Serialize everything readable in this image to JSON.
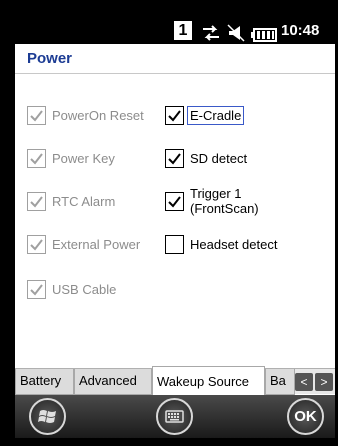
{
  "status_bar": {
    "indicator_number": "1",
    "time": "10:48"
  },
  "page": {
    "title": "Power"
  },
  "checkboxes_left": [
    {
      "label": "PowerOn Reset",
      "checked": true,
      "enabled": false
    },
    {
      "label": "Power Key",
      "checked": true,
      "enabled": false
    },
    {
      "label": "RTC Alarm",
      "checked": true,
      "enabled": false
    },
    {
      "label": "External Power",
      "checked": true,
      "enabled": false
    },
    {
      "label": "USB Cable",
      "checked": true,
      "enabled": false
    }
  ],
  "checkboxes_right": [
    {
      "label": "E-Cradle",
      "checked": true,
      "enabled": true,
      "focused": true
    },
    {
      "label": "SD detect",
      "checked": true,
      "enabled": true
    },
    {
      "label_line1": "Trigger 1",
      "label_line2": "(FrontScan)",
      "checked": true,
      "enabled": true
    },
    {
      "label": "Headset detect",
      "checked": false,
      "enabled": true
    }
  ],
  "tabs": [
    {
      "label": "Battery"
    },
    {
      "label": "Advanced"
    },
    {
      "label": "Wakeup Source",
      "active": true
    },
    {
      "label": "Ba"
    }
  ],
  "tab_nav": {
    "left": "<",
    "right": ">"
  },
  "bottom_bar": {
    "start_icon": "windows-start-icon",
    "keyboard_icon": "keyboard-icon",
    "ok_label": "OK"
  },
  "colors": {
    "title": "#1c3c94",
    "disabled_text": "#8c8c8c",
    "focus": "#3a59c8"
  }
}
